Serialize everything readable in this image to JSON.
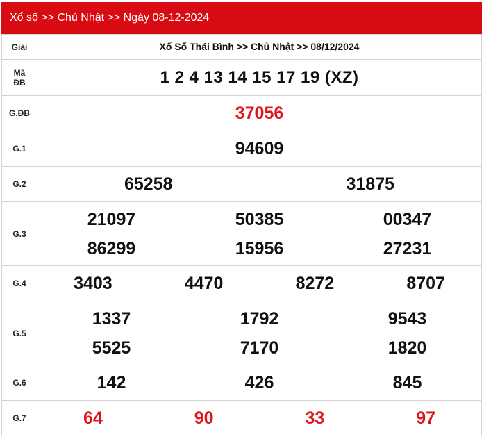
{
  "header": {
    "breadcrumb": "Xổ số >> Chủ Nhật >> Ngày 08-12-2024"
  },
  "table": {
    "title_prize_label": "Giải",
    "title_link": "Xổ Số Thái Bình",
    "title_rest": " >> Chủ Nhật >> 08/12/2024",
    "ma_db_label_1": "Mã",
    "ma_db_label_2": "ĐB",
    "ma_db_value": "1 2 4 13 14 15 17 19 (XZ)",
    "rows": {
      "gdb": {
        "label": "G.ĐB",
        "values": [
          "37056"
        ]
      },
      "g1": {
        "label": "G.1",
        "values": [
          "94609"
        ]
      },
      "g2": {
        "label": "G.2",
        "values": [
          "65258",
          "31875"
        ]
      },
      "g3": {
        "label": "G.3",
        "values": [
          "21097",
          "50385",
          "00347",
          "86299",
          "15956",
          "27231"
        ]
      },
      "g4": {
        "label": "G.4",
        "values": [
          "3403",
          "4470",
          "8272",
          "8707"
        ]
      },
      "g5": {
        "label": "G.5",
        "values": [
          "1337",
          "1792",
          "9543",
          "5525",
          "7170",
          "1820"
        ]
      },
      "g6": {
        "label": "G.6",
        "values": [
          "142",
          "426",
          "845"
        ]
      },
      "g7": {
        "label": "G.7",
        "values": [
          "64",
          "90",
          "33",
          "97"
        ]
      }
    }
  },
  "colors": {
    "header_bg": "#d80a12",
    "accent_red": "#e0141e"
  }
}
